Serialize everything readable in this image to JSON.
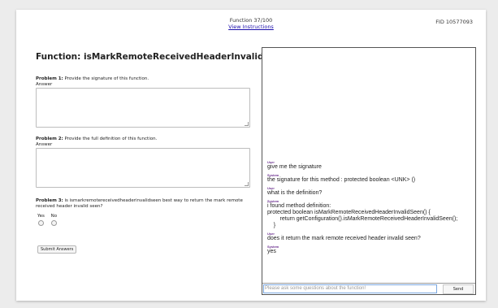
{
  "header": {
    "progress": "Function 37/100",
    "instructions_link": "View Instructions",
    "fid": "FID 10577093"
  },
  "function_title": "Function: isMarkRemoteReceivedHeaderInvalidSeen",
  "problems": [
    {
      "label": "Problem 1:",
      "text": " Provide the signature of this function.",
      "answer_label": "Answer"
    },
    {
      "label": "Problem 2:",
      "text": " Provide the full definition of this function.",
      "answer_label": "Answer"
    },
    {
      "label": "Problem 3:",
      "text": " is ismarkremotereceivedheaderinvalidseen best way to return the mark remote received header invalid seen?"
    }
  ],
  "options": [
    "Yes",
    "No"
  ],
  "submit_label": "Submit Answers",
  "chat": {
    "messages": [
      {
        "role": "User",
        "text": "give me the signature"
      },
      {
        "role": "System",
        "text": "the signature for this method : protected boolean <UNK> ()"
      },
      {
        "role": "User",
        "text": "what is the definition?"
      },
      {
        "role": "System",
        "text": "i found method definition:\nprotected boolean isMarkRemoteReceivedHeaderInvalidSeen() {\n        return getConfiguration().isMarkRemoteReceivedHeaderInvalidSeen();\n    }"
      },
      {
        "role": "User",
        "text": "does it return the mark remote received header invalid seen?"
      },
      {
        "role": "System",
        "text": "yes"
      }
    ],
    "input_placeholder": "Please ask some questions about the function!",
    "send_label": "Send"
  }
}
